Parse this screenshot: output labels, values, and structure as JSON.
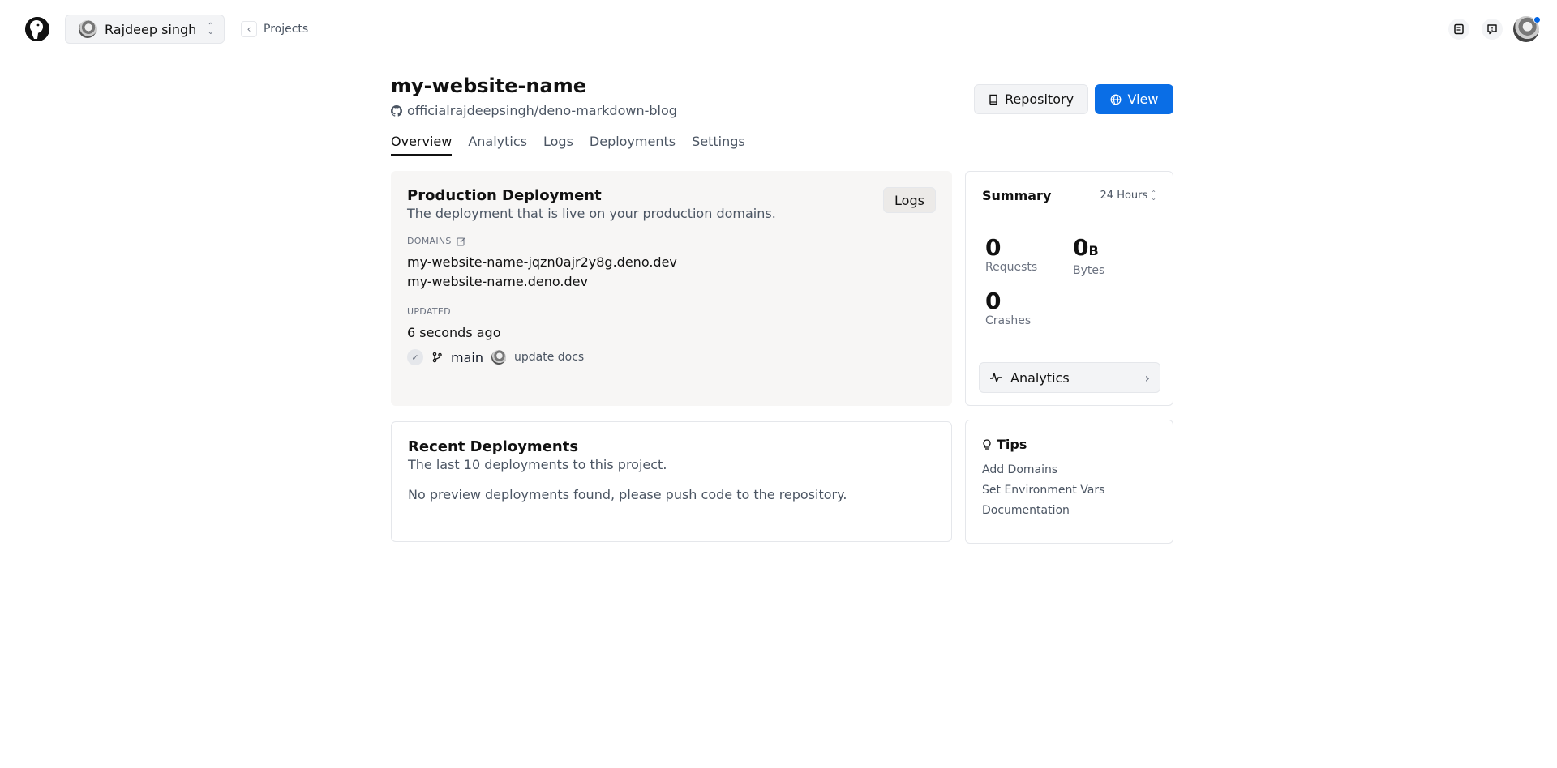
{
  "app": {
    "org_name": "Rajdeep singh",
    "back_label": "Projects"
  },
  "project": {
    "name": "my-website-name",
    "repo": "officialrajdeepsingh/deno-markdown-blog",
    "repo_button": "Repository",
    "view_button": "View"
  },
  "tabs": [
    {
      "label": "Overview",
      "active": true
    },
    {
      "label": "Analytics"
    },
    {
      "label": "Logs"
    },
    {
      "label": "Deployments"
    },
    {
      "label": "Settings"
    }
  ],
  "production": {
    "title": "Production Deployment",
    "subtitle": "The deployment that is live on your production domains.",
    "logs_button": "Logs",
    "domains_label": "DOMAINS",
    "domains": [
      "my-website-name-jqzn0ajr2y8g.deno.dev",
      "my-website-name.deno.dev"
    ],
    "updated_label": "UPDATED",
    "updated_value": "6 seconds ago",
    "branch": "main",
    "commit_message": "update docs"
  },
  "summary": {
    "title": "Summary",
    "range": "24 Hours",
    "requests_value": "0",
    "requests_label": "Requests",
    "bytes_value": "0",
    "bytes_unit": "B",
    "bytes_label": "Bytes",
    "crashes_value": "0",
    "crashes_label": "Crashes",
    "analytics_button": "Analytics"
  },
  "recent": {
    "title": "Recent Deployments",
    "subtitle": "The last 10 deployments to this project.",
    "empty_message": "No preview deployments found, please push code to the repository."
  },
  "tips": {
    "title": "Tips",
    "links": [
      "Add Domains",
      "Set Environment Vars",
      "Documentation"
    ]
  },
  "colors": {
    "accent": "#0a6ee6",
    "notification_dot": "#0064e5"
  }
}
